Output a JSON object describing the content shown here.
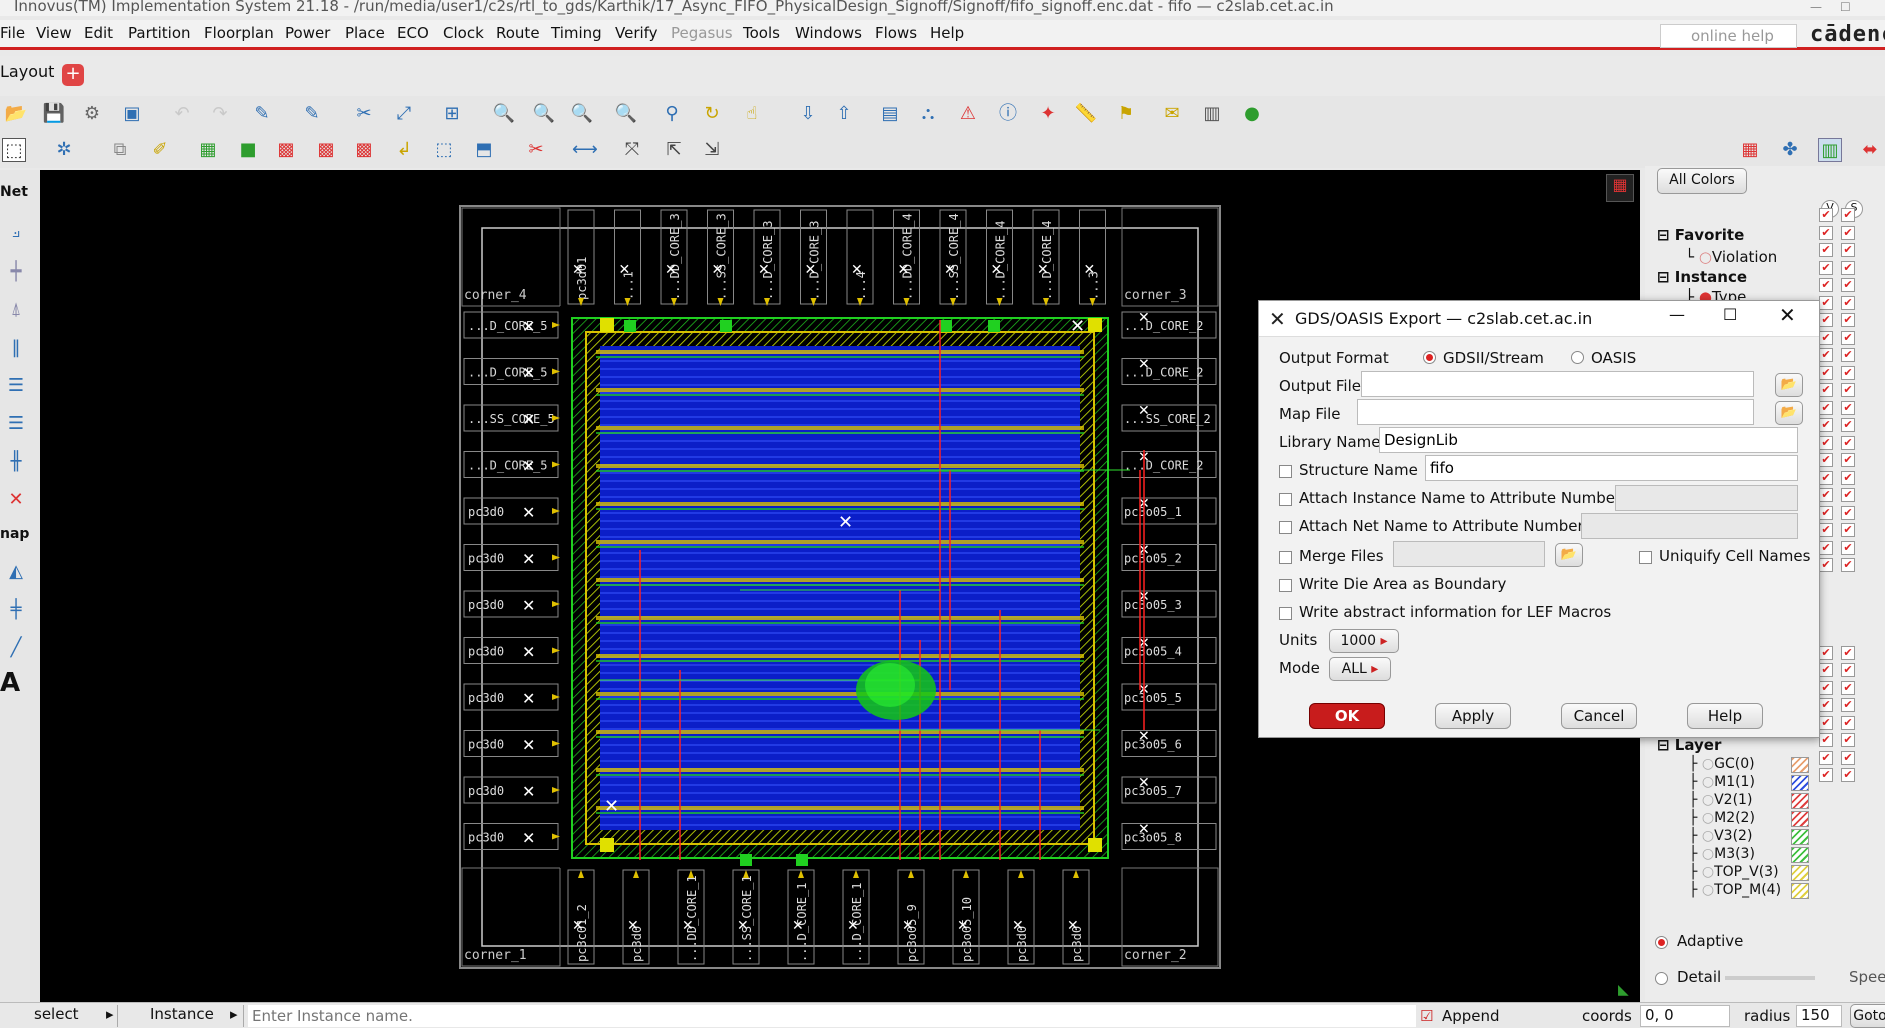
{
  "window": {
    "title": "Innovus(TM) Implementation System 21.18 - /run/media/user1/c2s/rtl_to_gds/Karthik/17_Async_FIFO_PhysicalDesign_Signoff/Signoff/fifo_signoff.enc.dat - fifo — c2slab.cet.ac.in"
  },
  "menu": [
    "File",
    "View",
    "Edit",
    "Partition",
    "Floorplan",
    "Power",
    "Place",
    "ECO",
    "Clock",
    "Route",
    "Timing",
    "Verify",
    "Pegasus",
    "Tools",
    "Windows",
    "Flows",
    "Help"
  ],
  "help_search": {
    "placeholder": "online help"
  },
  "brand": "cādence",
  "tab": {
    "label": "Layout"
  },
  "layout": {
    "corners": [
      "corner_4",
      "corner_3",
      "corner_1",
      "corner_2"
    ],
    "left_pads": [
      "...D_CORE_5",
      "...D_CORE_5",
      "...SS_CORE_5",
      "...D_CORE_5",
      "pc3d0",
      "pc3d0",
      "pc3d0",
      "pc3d0",
      "pc3d0",
      "pc3d0",
      "pc3d0",
      "pc3d0"
    ],
    "right_pads": [
      "...D_CORE_2",
      "...D_CORE_2",
      "...SS_CORE_2",
      "...D_CORE_2",
      "pc3o05_1",
      "pc3o05_2",
      "pc3o05_3",
      "pc3o05_4",
      "pc3o05_5",
      "pc3o05_6",
      "pc3o05_7",
      "pc3o05_8"
    ],
    "top_pads": [
      "pc3d01",
      "...1",
      "...DD_CORE_3",
      "...SS_CORE_3",
      "...D_CORE_3",
      "...D_CORE_3",
      "...4",
      "...DD_CORE_4",
      "...SS_CORE_4",
      "...D_CORE_4",
      "...D_CORE_4",
      "...3"
    ],
    "bottom_pads": [
      "pc3c01_2",
      "pc3d0",
      "...DD_CORE_1",
      "...SS_CORE_1",
      "...D_CORE_1",
      "...D_CORE_1",
      "pc3o05_9",
      "pc3o05_10",
      "pc3d0",
      "pc3d0"
    ]
  },
  "right_panel": {
    "all_colors": "All Colors",
    "vs": [
      "V",
      "S"
    ],
    "tree": [
      {
        "label": "Favorite",
        "bold": true
      },
      {
        "label": "Violation",
        "bold": false
      },
      {
        "label": "Instance",
        "bold": true
      },
      {
        "label": "Type",
        "bold": false
      }
    ],
    "layer_header": "Layer",
    "layers": [
      {
        "name": "GC(0)",
        "color": "#e8a070"
      },
      {
        "name": "M1(1)",
        "color": "#3050e0"
      },
      {
        "name": "V2(1)",
        "color": "#e04040"
      },
      {
        "name": "M2(2)",
        "color": "#e04040"
      },
      {
        "name": "V3(2)",
        "color": "#40c040"
      },
      {
        "name": "M3(3)",
        "color": "#40c040"
      },
      {
        "name": "TOP_V(3)",
        "color": "#e0d040"
      },
      {
        "name": "TOP_M(4)",
        "color": "#e0d040"
      }
    ],
    "adaptive": "Adaptive",
    "detail": "Detail",
    "speed": "Speed"
  },
  "dialog": {
    "title": "GDS/OASIS Export — c2slab.cet.ac.in",
    "output_format_label": "Output Format",
    "format_options": [
      "GDSII/Stream",
      "OASIS"
    ],
    "output_file_label": "Output File",
    "output_file_value": "",
    "map_file_label": "Map File",
    "map_file_value": "",
    "library_name_label": "Library Name",
    "library_name_value": "DesignLib",
    "structure_name_label": "Structure Name",
    "structure_name_value": "fifo",
    "attach_instance_label": "Attach Instance Name to Attribute Number",
    "attach_net_label": "Attach Net Name to Attribute Number",
    "merge_files_label": "Merge Files",
    "uniquify_label": "Uniquify Cell Names",
    "write_die_area_label": "Write Die Area as Boundary",
    "write_abstract_label": "Write abstract information for LEF Macros",
    "units_label": "Units",
    "units_value": "1000",
    "mode_label": "Mode",
    "mode_value": "ALL",
    "buttons": {
      "ok": "OK",
      "apply": "Apply",
      "cancel": "Cancel",
      "help": "Help"
    }
  },
  "status": {
    "mode": "select",
    "object": "Instance",
    "input_placeholder": "Enter Instance name.",
    "append": "Append",
    "coords_label": "coords",
    "coords_value": "0, 0",
    "radius_label": "radius",
    "radius_value": "150",
    "goto": "Goto"
  }
}
